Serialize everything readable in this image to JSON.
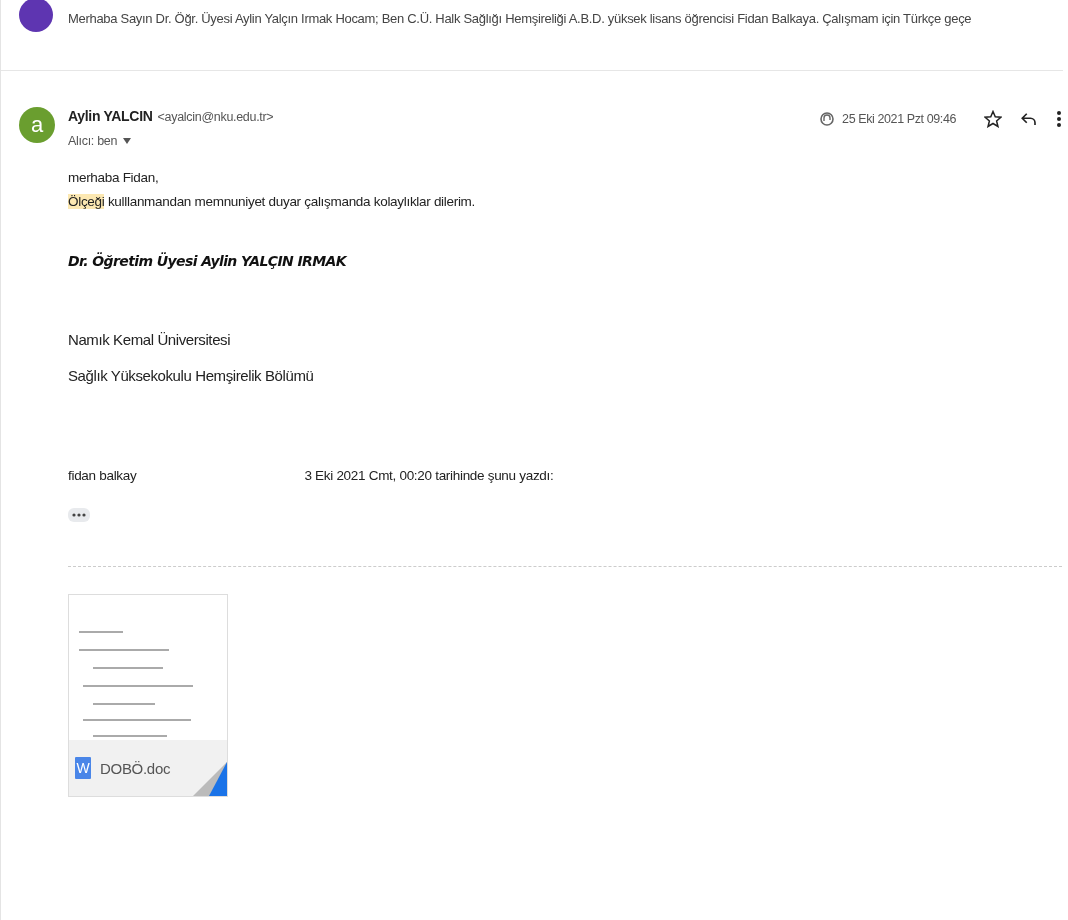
{
  "collapsed_message": {
    "snippet": "Merhaba Sayın Dr. Öğr. Üyesi Aylin Yalçın Irmak Hocam; Ben C.Ü. Halk Sağlığı Hemşireliği A.B.D. yüksek lisans öğrencisi Fidan Balkaya. Çalışmam için Türkçe geçe"
  },
  "message": {
    "avatar_letter": "a",
    "sender_name": "Aylin YALCIN",
    "sender_email": "<ayalcin@nku.edu.tr>",
    "recipient": "Alıcı: ben",
    "date": "25 Eki 2021 Pzt 09:46",
    "starred": false,
    "greeting": "merhaba Fidan,",
    "body": {
      "highlight": "Ölçeği",
      "rest": " kulllanmandan memnuniyet duyar çalışmanda kolaylıklar dilerim."
    },
    "signature": "Dr. Öğretim Üyesi Aylin YALÇIN IRMAK",
    "affiliation": [
      "Namık Kemal Üniversitesi",
      "Sağlık Yüksekokulu Hemşirelik Bölümü"
    ],
    "quote_header": {
      "start": "fidan balkay",
      "end": "3 Eki 2021 Cmt, 00:20 tarihinde şunu yazdı:"
    }
  },
  "attachments": [
    {
      "icon_letter": "W",
      "name": "DOBÖ.doc"
    }
  ]
}
